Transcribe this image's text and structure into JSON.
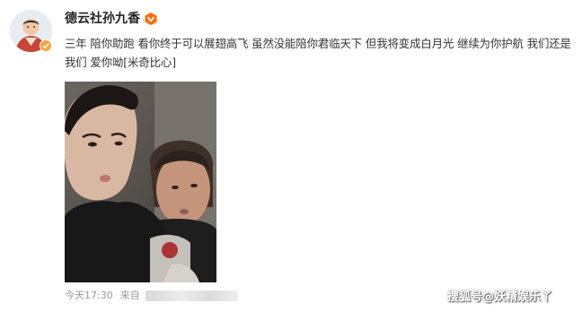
{
  "post": {
    "username": "德云社孙九香",
    "text": "三年 陪你助跑 看你终于可以展翅高飞 虽然没能陪你君临天下 但我将变成白月光 继续为你护航 我们还是我们 爱你呦[米奇比心]",
    "time": "今天17:30",
    "source_prefix": "来自"
  },
  "watermark": "搜狐号@妖精娱乐丫",
  "icons": {
    "avatar": "avatar",
    "verified": "verified-badge-icon",
    "vip": "vip-badge-icon"
  },
  "colors": {
    "verified": "#f7a43a",
    "vip": "#ff6a00",
    "meta": "#999999"
  }
}
